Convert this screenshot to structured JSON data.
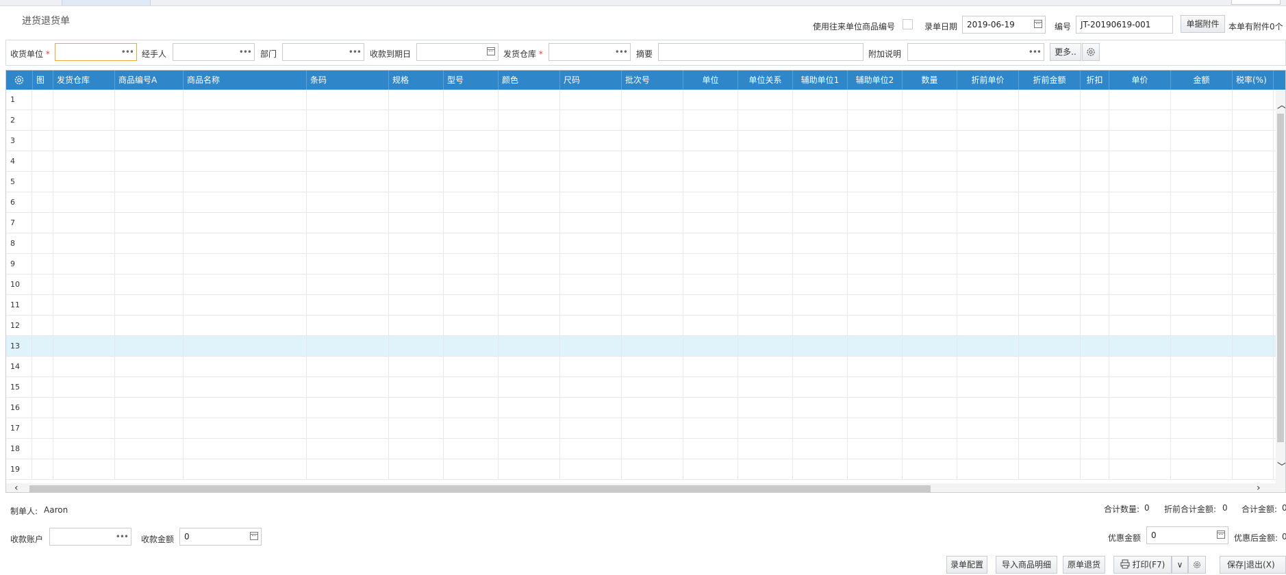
{
  "page": {
    "title": "进货退货单"
  },
  "topbar": {
    "use_partner_code_label": "使用往来单位商品编号",
    "date_label": "录单日期",
    "date_value": "2019-06-19",
    "number_label": "编号",
    "number_value": "JT-20190619-001",
    "attach_button": "单据附件",
    "attach_count": "本单有附件0个"
  },
  "filters": {
    "receiver_label": "收货单位",
    "handler_label": "经手人",
    "dept_label": "部门",
    "due_date_label": "收款到期日",
    "warehouse_label": "发货仓库",
    "summary_label": "摘要",
    "note_label": "附加说明",
    "more_button": "更多..",
    "required_mark": "*",
    "ellipsis": "•••"
  },
  "grid": {
    "columns": [
      "图",
      "发货仓库",
      "商品编号A",
      "商品名称",
      "条码",
      "规格",
      "型号",
      "颜色",
      "尺码",
      "批次号",
      "单位",
      "单位关系",
      "辅助单位1",
      "辅助单位2",
      "数量",
      "折前单价",
      "折前金额",
      "折扣",
      "单价",
      "金额",
      "税率(%)"
    ],
    "rows": [
      "1",
      "2",
      "3",
      "4",
      "5",
      "6",
      "7",
      "8",
      "9",
      "10",
      "11",
      "12",
      "13",
      "14",
      "15",
      "16",
      "17",
      "18",
      "19"
    ],
    "selected_row": "13"
  },
  "footer": {
    "creator_label": "制单人:",
    "creator_value": "Aaron",
    "total_qty_label": "合计数量:",
    "total_qty_value": "0",
    "total_pre_label": "折前合计金额:",
    "total_pre_value": "0",
    "total_amount_label": "合计金额:",
    "total_amount_value": "0",
    "account_label": "收款账户",
    "receipt_amount_label": "收款金额",
    "receipt_amount_value": "0",
    "discount_label": "优惠金额",
    "discount_value": "0",
    "after_discount_label": "优惠后金额:",
    "after_discount_value": "0"
  },
  "actions": {
    "config": "录单配置",
    "import": "导入商品明细",
    "return": "原单退货",
    "print": "打印(F7)",
    "save_exit": "保存|退出(X)"
  }
}
